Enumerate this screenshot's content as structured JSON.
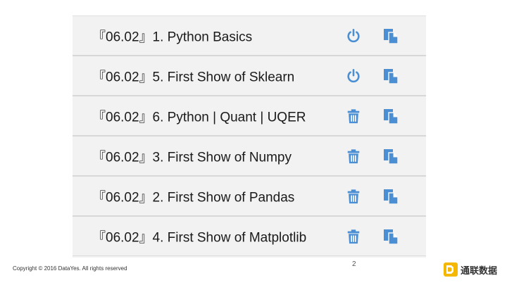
{
  "list": {
    "items": [
      {
        "date": "『06.02』",
        "title": "1. Python Basics",
        "action": "power-icon"
      },
      {
        "date": "『06.02』",
        "title": "5. First Show of Sklearn",
        "action": "power-icon"
      },
      {
        "date": "『06.02』",
        "title": "6. Python | Quant | UQER",
        "action": "trash-icon"
      },
      {
        "date": "『06.02』",
        "title": "3. First Show of Numpy",
        "action": "trash-icon"
      },
      {
        "date": "『06.02』",
        "title": "2. First Show of Pandas",
        "action": "trash-icon"
      },
      {
        "date": "『06.02』",
        "title": "4. First Show of Matplotlib",
        "action": "trash-icon"
      }
    ]
  },
  "colors": {
    "icon_blue": "#4a8fd4",
    "row_bg": "#f2f2f2",
    "logo_yellow": "#f5b800"
  },
  "footer": {
    "page_number": "2",
    "copyright": "Copyright © 2016 DataYes. All rights reserved",
    "logo_text": "通联数据"
  }
}
